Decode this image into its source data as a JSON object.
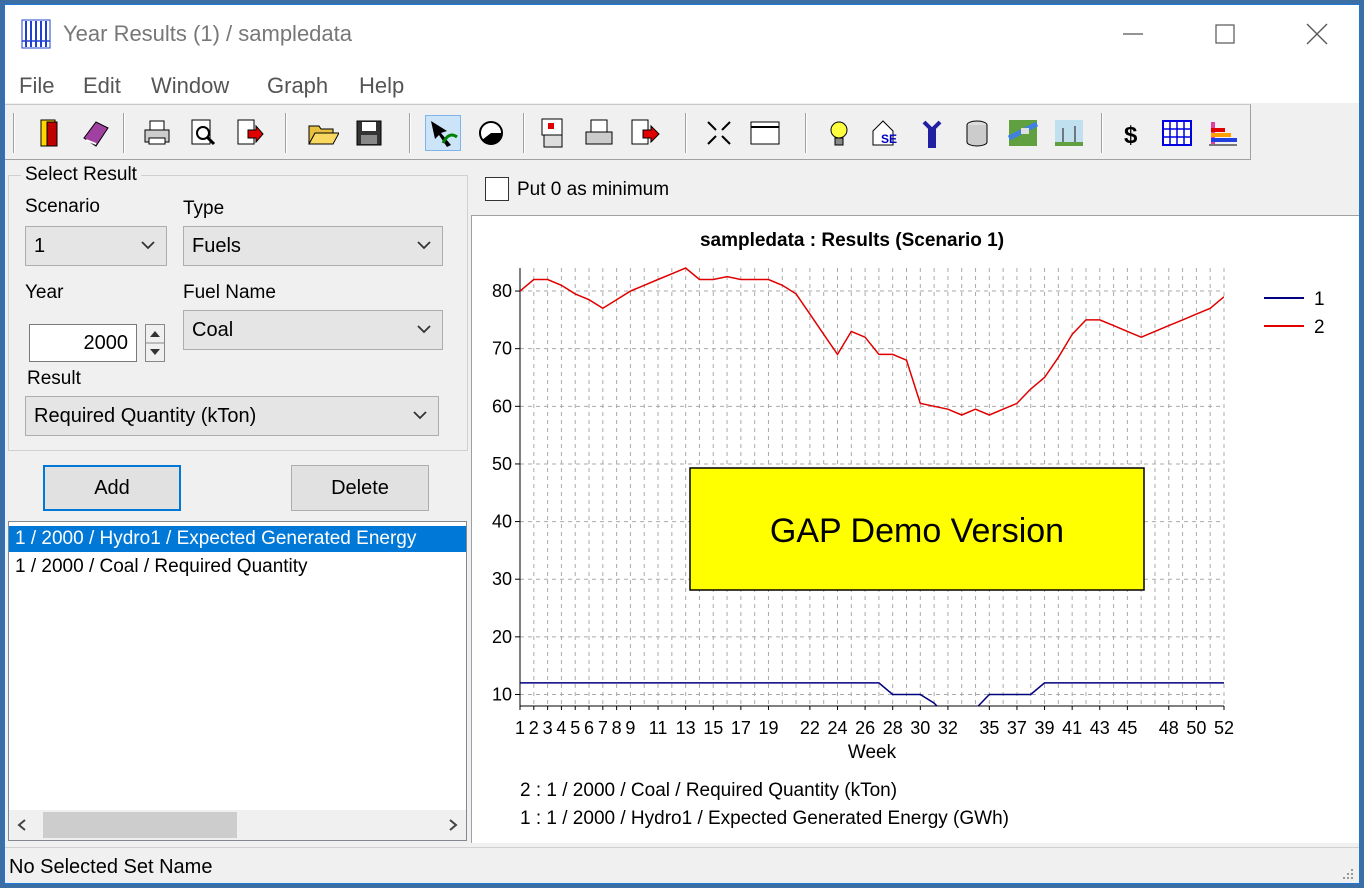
{
  "window": {
    "title": "Year Results (1)  /  sampledata"
  },
  "menu": [
    "File",
    "Edit",
    "Window",
    "Graph",
    "Help"
  ],
  "toolbar_icons": [
    "exit-icon",
    "book-icon",
    "print-icon",
    "print-preview-icon",
    "export-icon",
    "open-folder-icon",
    "save-icon",
    "pointer-icon",
    "pie-icon",
    "copy-chart-icon",
    "print-chart-icon",
    "export-chart-icon",
    "zoom-icon",
    "window-icon",
    "bulb-icon",
    "house-icon",
    "tools-icon",
    "database-icon",
    "map-icon",
    "wind-icon",
    "dollar-icon",
    "grid-icon",
    "chart-icon"
  ],
  "select": {
    "group_label": "Select Result",
    "scenario_label": "Scenario",
    "scenario_value": "1",
    "type_label": "Type",
    "type_value": "Fuels",
    "year_label": "Year",
    "year_value": "2000",
    "fuel_label": "Fuel Name",
    "fuel_value": "Coal",
    "result_label": "Result",
    "result_value": "Required Quantity (kTon)"
  },
  "buttons": {
    "add": "Add",
    "delete": "Delete"
  },
  "result_list": [
    "1 / 2000 / Hydro1 / Expected Generated Energy",
    "1 / 2000 / Coal / Required Quantity"
  ],
  "put_zero_label": "Put 0 as minimum",
  "watermark": "GAP Demo Version",
  "status": "No Selected Set Name",
  "colors": {
    "series1": "#00007f",
    "series2": "#e00000",
    "watermark_bg": "#ffff00",
    "selection": "#0078d7"
  },
  "chart_data": {
    "type": "line",
    "title": "sampledata : Results (Scenario 1)",
    "xlabel": "Week",
    "ylabel": "",
    "xlim": [
      1,
      52
    ],
    "ylim": [
      8,
      84
    ],
    "yticks": [
      10,
      20,
      30,
      40,
      50,
      60,
      70,
      80
    ],
    "xtick_labels": [
      "1",
      "2",
      "3",
      "4",
      "5",
      "6",
      "7",
      "8",
      "9",
      "11",
      "13",
      "15",
      "17",
      "19",
      "22",
      "24",
      "26",
      "28",
      "30",
      "32",
      "35",
      "37",
      "39",
      "41",
      "43",
      "45",
      "48",
      "50",
      "52"
    ],
    "grid": true,
    "legend_position": "top-right",
    "legend_entries": [
      "1",
      "2"
    ],
    "caption_lines": [
      "2 : 1 / 2000 / Coal / Required Quantity (kTon)",
      "1 : 1 / 2000 / Hydro1 / Expected Generated Energy (GWh)"
    ],
    "series": [
      {
        "name": "1",
        "x": [
          1,
          2,
          3,
          4,
          5,
          6,
          7,
          8,
          9,
          10,
          11,
          12,
          13,
          14,
          15,
          16,
          17,
          18,
          19,
          20,
          21,
          22,
          23,
          24,
          25,
          26,
          27,
          28,
          29,
          30,
          31,
          32,
          33,
          34,
          35,
          36,
          37,
          38,
          39,
          40,
          41,
          42,
          43,
          44,
          45,
          46,
          47,
          48,
          49,
          50,
          51,
          52
        ],
        "values": [
          12,
          12,
          12,
          12,
          12,
          12,
          12,
          12,
          12,
          12,
          12,
          12,
          12,
          12,
          12,
          12,
          12,
          12,
          12,
          12,
          12,
          12,
          12,
          12,
          12,
          12,
          12,
          10,
          10,
          10,
          8.5,
          6,
          6,
          7.5,
          10,
          10,
          10,
          10,
          12,
          12,
          12,
          12,
          12,
          12,
          12,
          12,
          12,
          12,
          12,
          12,
          12,
          12
        ]
      },
      {
        "name": "2",
        "x": [
          1,
          2,
          3,
          4,
          5,
          6,
          7,
          8,
          9,
          10,
          11,
          12,
          13,
          14,
          15,
          16,
          17,
          18,
          19,
          20,
          21,
          22,
          23,
          24,
          25,
          26,
          27,
          28,
          29,
          30,
          31,
          32,
          33,
          34,
          35,
          36,
          37,
          38,
          39,
          40,
          41,
          42,
          43,
          44,
          45,
          46,
          47,
          48,
          49,
          50,
          51,
          52
        ],
        "values": [
          80,
          82,
          82,
          81,
          79.5,
          78.5,
          77,
          78.5,
          80,
          81,
          82,
          83,
          84,
          82,
          82,
          82.5,
          82,
          82,
          82,
          81,
          79.5,
          76,
          72.5,
          69,
          73,
          72,
          69,
          69,
          68,
          60.5,
          60,
          59.5,
          58.5,
          59.5,
          58.5,
          59.5,
          60.5,
          63,
          65,
          68.5,
          72.5,
          75,
          75,
          74,
          73,
          72,
          73,
          74,
          75,
          76,
          77,
          79
        ]
      }
    ]
  }
}
